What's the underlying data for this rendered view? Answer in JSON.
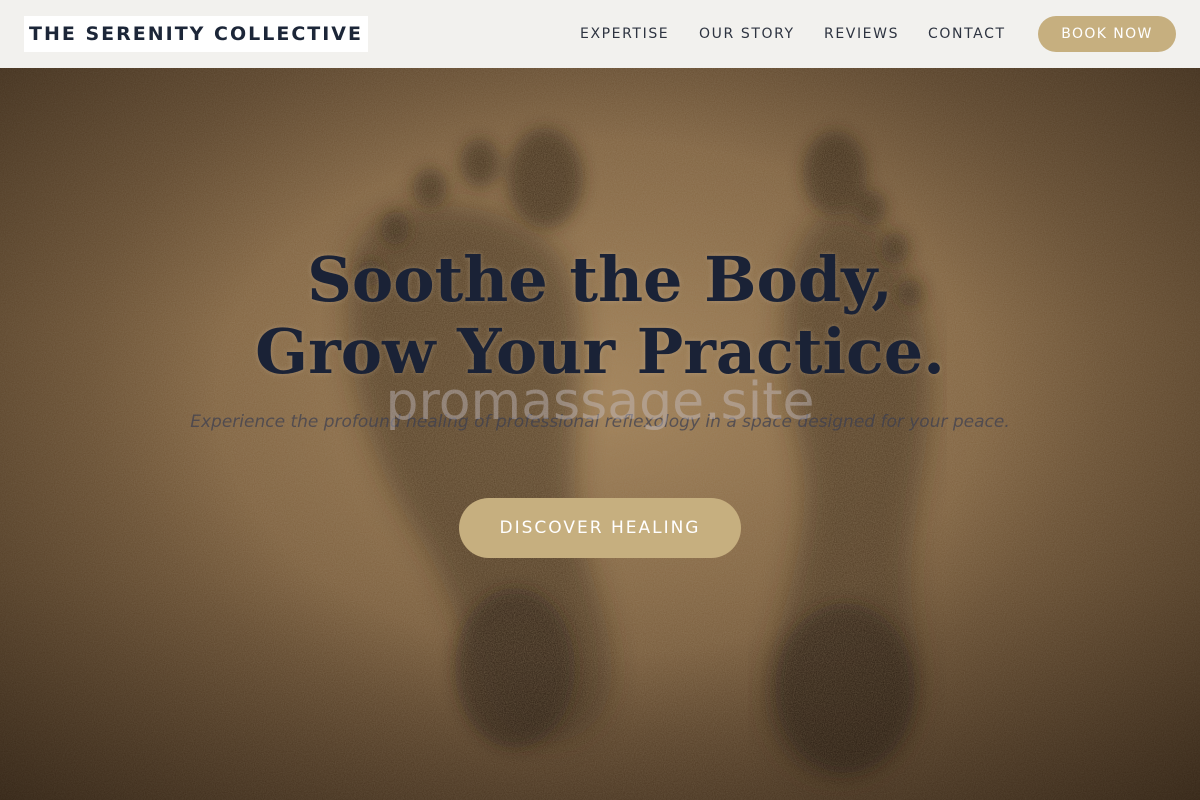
{
  "header": {
    "logo_text": "THE SERENITY COLLECTIVE",
    "nav": [
      {
        "label": "EXPERTISE"
      },
      {
        "label": "OUR STORY"
      },
      {
        "label": "REVIEWS"
      },
      {
        "label": "CONTACT"
      }
    ],
    "book_label": "BOOK NOW"
  },
  "hero": {
    "headline_line1": "Soothe the Body,",
    "headline_line2": "Grow Your Practice.",
    "subtitle": "Experience the profound healing of professional reflexology in a space designed for your peace.",
    "cta_label": "DISCOVER HEALING",
    "watermark": "promassage.site"
  },
  "colors": {
    "accent": "#c6af7f",
    "header_bg": "#f2f1ee",
    "headline": "#1a2236"
  }
}
